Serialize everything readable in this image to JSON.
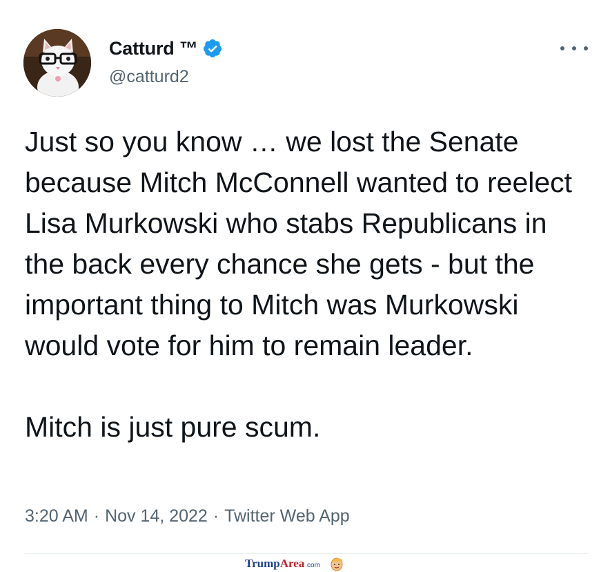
{
  "author": {
    "display_name": "Catturd ™",
    "handle": "@catturd2",
    "verified_icon": "verified-badge-icon",
    "avatar_icon": "cat-with-glasses-avatar"
  },
  "tweet": {
    "paragraph_1": "Just so you know … we lost the Senate because Mitch McConnell wanted to reelect Lisa Murkowski who stabs Republicans in the back every chance she gets - but the important thing to Mitch was Murkowski would vote for him to remain leader.",
    "paragraph_2": "Mitch is just pure scum."
  },
  "meta": {
    "time": "3:20 AM",
    "separator": "·",
    "date": "Nov 14, 2022",
    "source": "Twitter Web App"
  },
  "watermark": {
    "brand_part1": "Trump",
    "brand_part2": "Area",
    "brand_suffix": ".com"
  },
  "colors": {
    "text_primary": "#0f1419",
    "text_secondary": "#536471",
    "verified_blue": "#1d9bf0",
    "divider": "#e6ecf0"
  }
}
